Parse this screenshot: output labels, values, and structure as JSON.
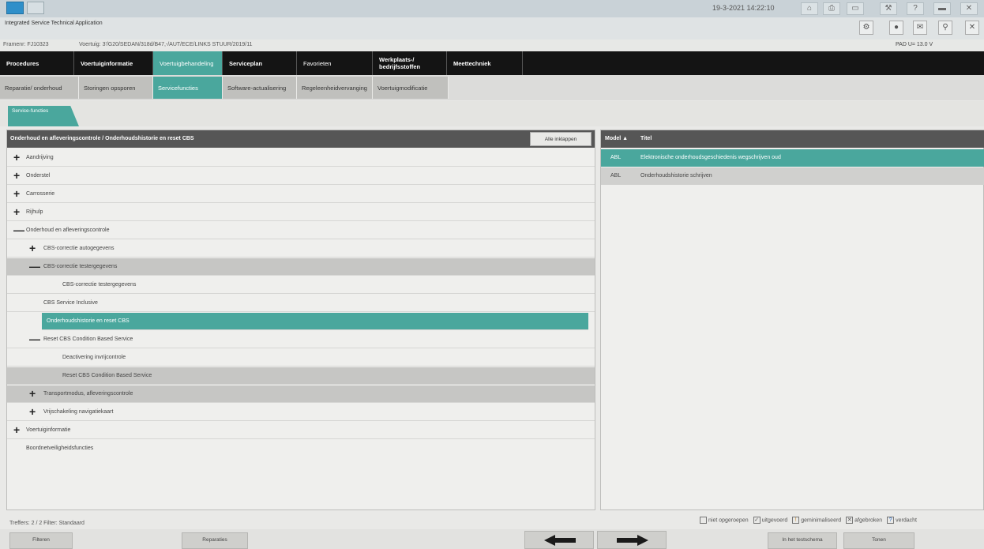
{
  "topbar": {
    "datetime": "19-3-2021 14:22:10"
  },
  "app": {
    "title": "Integrated Service Technical Application"
  },
  "vehicle": {
    "frame": "Framenr: FJ10323",
    "info": "Voertuig: 3'/G20/SEDAN/318d/B47,-/AUT/ECE/LINKS STUUR/2019/11",
    "pad": "PAD   U= 13.0 V"
  },
  "mainnav": [
    {
      "label": "Procedures"
    },
    {
      "label": "Voertuiginformatie"
    },
    {
      "label": "Voertuigbehandeling"
    },
    {
      "label": "Serviceplan"
    },
    {
      "label": "Favorieten"
    },
    {
      "label": "Werkplaats-/ bedrijfsstoffen"
    },
    {
      "label": "Meettechniek"
    }
  ],
  "subnav": [
    {
      "label": "Reparatie/ onderhoud"
    },
    {
      "label": "Storingen opsporen"
    },
    {
      "label": "Servicefuncties"
    },
    {
      "label": "Software-actualisering"
    },
    {
      "label": "Regeleenheidvervanging"
    },
    {
      "label": "Voertuigmodificatie"
    }
  ],
  "tab": {
    "label": "Service-functies"
  },
  "left_panel": {
    "header": "Onderhoud en afleveringscontrole / Onderhoudshistorie en reset CBS",
    "collapse_label": "Alle inklappen",
    "tree": [
      {
        "label": "Aandrijving",
        "sym": "+"
      },
      {
        "label": "Onderstel",
        "sym": "+"
      },
      {
        "label": "Carrosserie",
        "sym": "+"
      },
      {
        "label": "Rijhulp",
        "sym": "+"
      },
      {
        "label": "Onderhoud en afleveringscontrole",
        "sym": "—"
      },
      {
        "label": "CBS-correctie autogegevens",
        "sym": "+"
      },
      {
        "label": "CBS-correctie testergegevens",
        "sym": "—"
      },
      {
        "label": "CBS-correctie testergegevens",
        "sym": ""
      },
      {
        "label": "CBS Service Inclusive",
        "sym": ""
      },
      {
        "label": "Onderhoudshistorie en reset CBS",
        "sym": ""
      },
      {
        "label": "Reset CBS Condition Based Service",
        "sym": "—"
      },
      {
        "label": "Deactivering invrijcontrole",
        "sym": ""
      },
      {
        "label": "Reset CBS Condition Based Service",
        "sym": ""
      },
      {
        "label": "Transportmodus, afleveringscontrole",
        "sym": "+"
      },
      {
        "label": "Vrijschakeling navigatiekaart",
        "sym": "+"
      },
      {
        "label": "Voertuiginformatie",
        "sym": "+"
      },
      {
        "label": "Boordnetveiligheidsfuncties",
        "sym": ""
      }
    ]
  },
  "right_panel": {
    "col_model": "Model ▲",
    "col_title": "Titel",
    "rows": [
      {
        "model": "ABL",
        "title": "Elektronische onderhoudsgeschiedenis wegschrijven oud"
      },
      {
        "model": "ABL",
        "title": "Onderhoudshistorie schrijven"
      }
    ]
  },
  "status": {
    "hits": "Treffers: 2 / 2  Filter:  Standaard",
    "legend": [
      {
        "label": "niet opgeroepen",
        "mark": "",
        "color": "#888888"
      },
      {
        "label": "uitgevoerd",
        "mark": "✓",
        "color": "#333333"
      },
      {
        "label": "geminimaliseerd",
        "mark": "!",
        "color": "#c98a2a"
      },
      {
        "label": "afgebroken",
        "mark": "✕",
        "color": "#333333"
      },
      {
        "label": "verdacht",
        "mark": "?",
        "color": "#2f6fc9"
      }
    ]
  },
  "bottom": {
    "filter_btn": "Filteren",
    "repairs_btn": "Reparaties",
    "testplan_btn": "In het testschema",
    "show_btn": "Tonen"
  }
}
